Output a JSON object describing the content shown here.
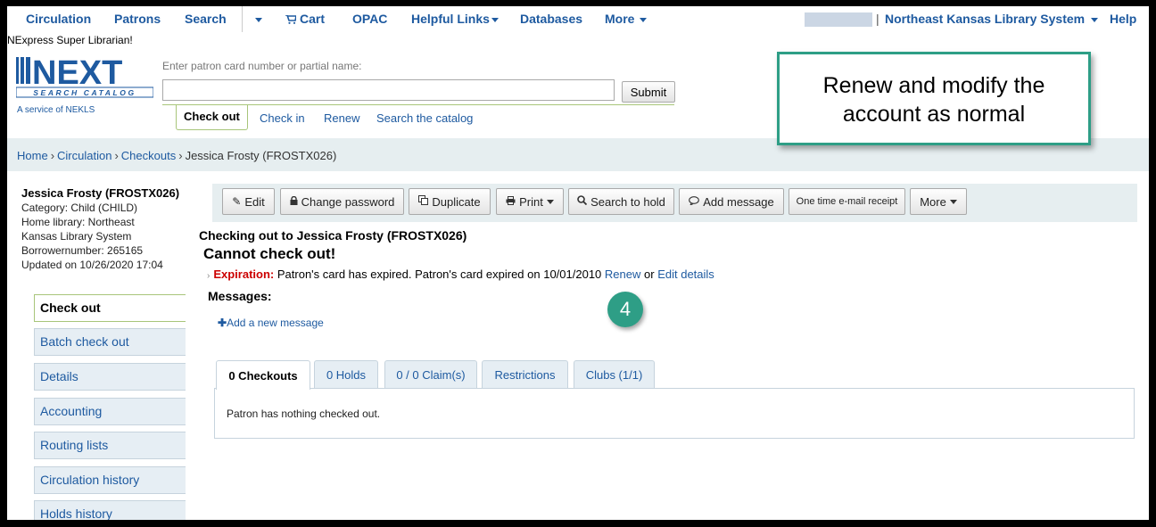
{
  "topnav": {
    "circulation": "Circulation",
    "patrons": "Patrons",
    "search": "Search",
    "cart": "Cart",
    "opac": "OPAC",
    "helpful_links": "Helpful Links",
    "databases": "Databases",
    "more": "More",
    "library": "Northeast Kansas Library System",
    "help": "Help",
    "separator": "|"
  },
  "user_line": "NExpress Super Librarian!",
  "logo": {
    "word": "NEXT",
    "sub": "SEARCH CATALOG",
    "service": "A service of NEKLS"
  },
  "search": {
    "hint": "Enter patron card number or partial name:",
    "value": "",
    "submit": "Submit",
    "tabs": [
      "Check out",
      "Check in",
      "Renew",
      "Search the catalog"
    ]
  },
  "callout": {
    "line1": "Renew and modify the",
    "line2": "account as normal"
  },
  "breadcrumb": {
    "home": "Home",
    "circulation": "Circulation",
    "checkouts": "Checkouts",
    "current": "Jessica Frosty (FROSTX026)",
    "sep": "›"
  },
  "patron": {
    "name": "Jessica Frosty (FROSTX026)",
    "category": "Category: Child (CHILD)",
    "home_library_1": "Home library: Northeast",
    "home_library_2": "Kansas Library System",
    "borrowernumber": "Borrowernumber: 265165",
    "updated": "Updated on 10/26/2020 17:04"
  },
  "side_menu": [
    "Check out",
    "Batch check out",
    "Details",
    "Accounting",
    "Routing lists",
    "Circulation history",
    "Holds history"
  ],
  "toolbar": {
    "edit": "Edit",
    "change_password": "Change password",
    "duplicate": "Duplicate",
    "print": "Print",
    "search_to_hold": "Search to hold",
    "add_message": "Add message",
    "one_time_receipt": "One time e-mail receipt",
    "more": "More"
  },
  "checkout": {
    "title": "Checking out to Jessica Frosty (FROSTX026)",
    "cannot": "Cannot check out!",
    "expiration_label": "Expiration:",
    "expiration_text": "Patron's card has expired. Patron's card expired on 10/01/2010",
    "renew_link": "Renew",
    "or": "or",
    "edit_details_link": "Edit details",
    "messages_heading": "Messages:",
    "add_message": "Add a new message"
  },
  "step_badge": "4",
  "patron_tabs": [
    "0 Checkouts",
    "0 Holds",
    "0 / 0 Claim(s)",
    "Restrictions",
    "Clubs (1/1)"
  ],
  "tab_panel_message": "Patron has nothing checked out.",
  "colors": {
    "link": "#1e5aa0",
    "accent_teal": "#2e9e86",
    "tab_green": "#a8c57a",
    "error_red": "#cc0000"
  }
}
